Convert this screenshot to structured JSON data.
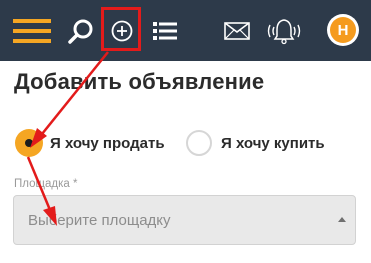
{
  "header": {
    "icons": [
      "hamburger-menu-icon",
      "search-icon",
      "add-circle-icon",
      "list-icon",
      "envelope-icon",
      "bell-icon",
      "user-avatar-icon"
    ],
    "avatar_letter": "Н",
    "highlight_color": "#e31b1b",
    "accent_color": "#f5a623",
    "background_color": "#2d3a4a"
  },
  "page": {
    "title": "Добавить объявление"
  },
  "form": {
    "radio_sell_label": "Я хочу продать",
    "radio_buy_label": "Я хочу купить",
    "selected_option": "Я хочу продать",
    "platform_label": "Площадка *",
    "platform_placeholder": "Выберите площадку"
  }
}
